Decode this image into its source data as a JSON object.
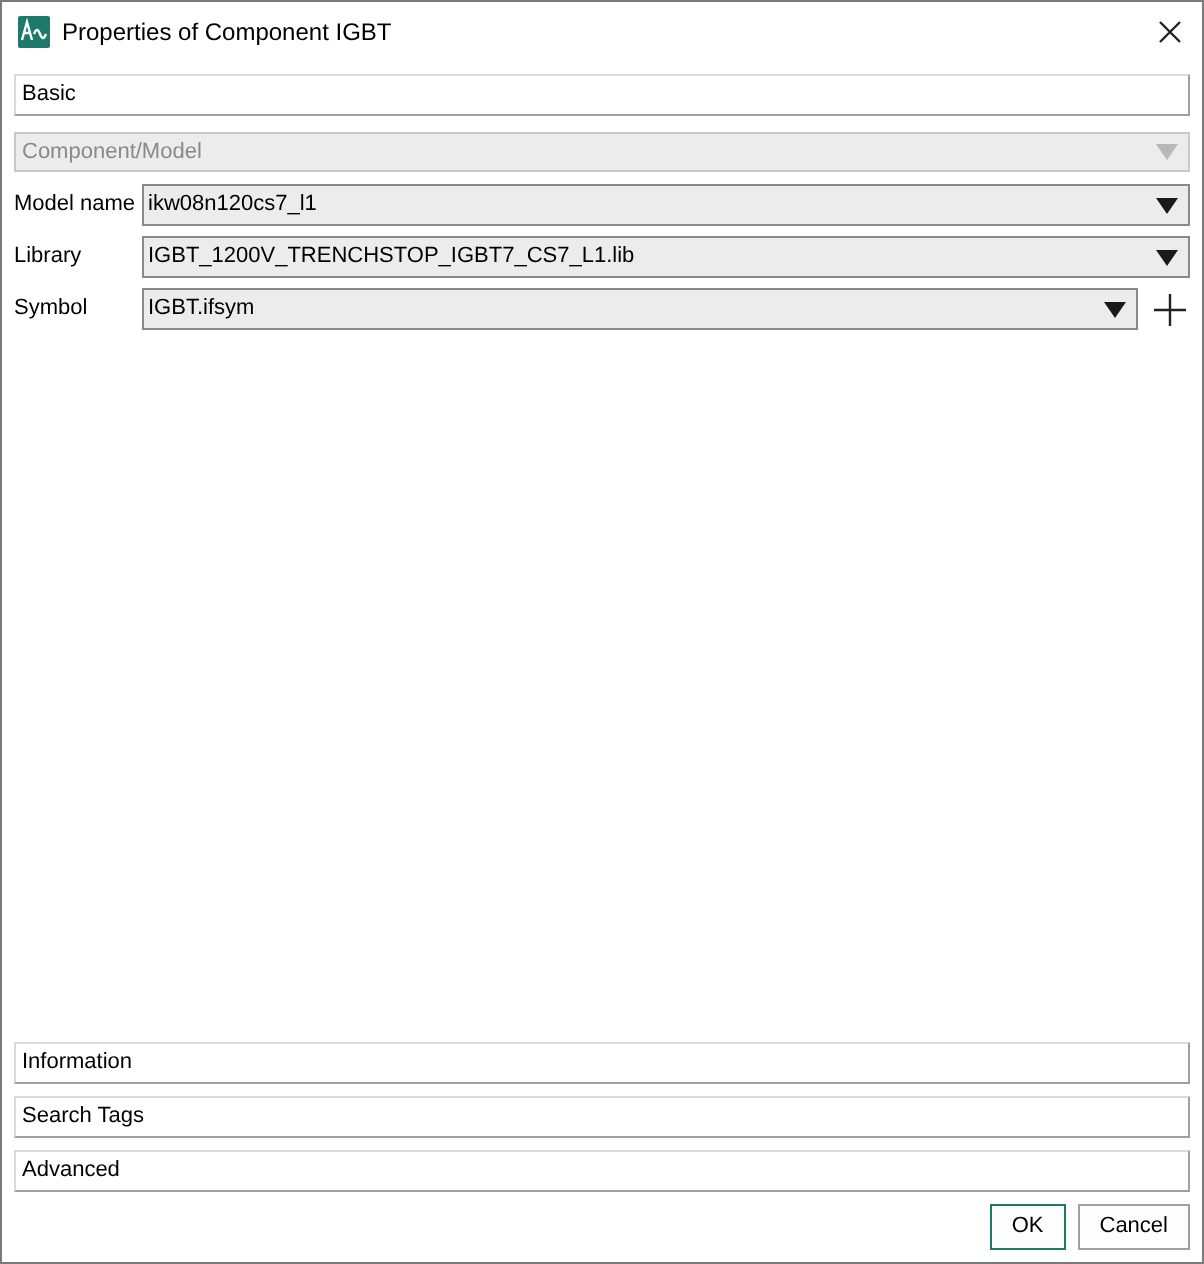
{
  "window": {
    "title": "Properties of Component IGBT"
  },
  "sections_top": [
    {
      "label": "Basic"
    }
  ],
  "component_model": {
    "value": "Component/Model",
    "disabled": true
  },
  "fields": [
    {
      "label": "Model name",
      "value": "ikw08n120cs7_l1",
      "add_button": false
    },
    {
      "label": "Library",
      "value": "IGBT_1200V_TRENCHSTOP_IGBT7_CS7_L1.lib",
      "add_button": false
    },
    {
      "label": "Symbol",
      "value": "IGBT.ifsym",
      "add_button": true
    }
  ],
  "sections_bottom": [
    {
      "label": "Information"
    },
    {
      "label": "Search Tags"
    },
    {
      "label": "Advanced"
    }
  ],
  "buttons": [
    {
      "label": "OK",
      "default": true
    },
    {
      "label": "Cancel",
      "default": false
    }
  ]
}
